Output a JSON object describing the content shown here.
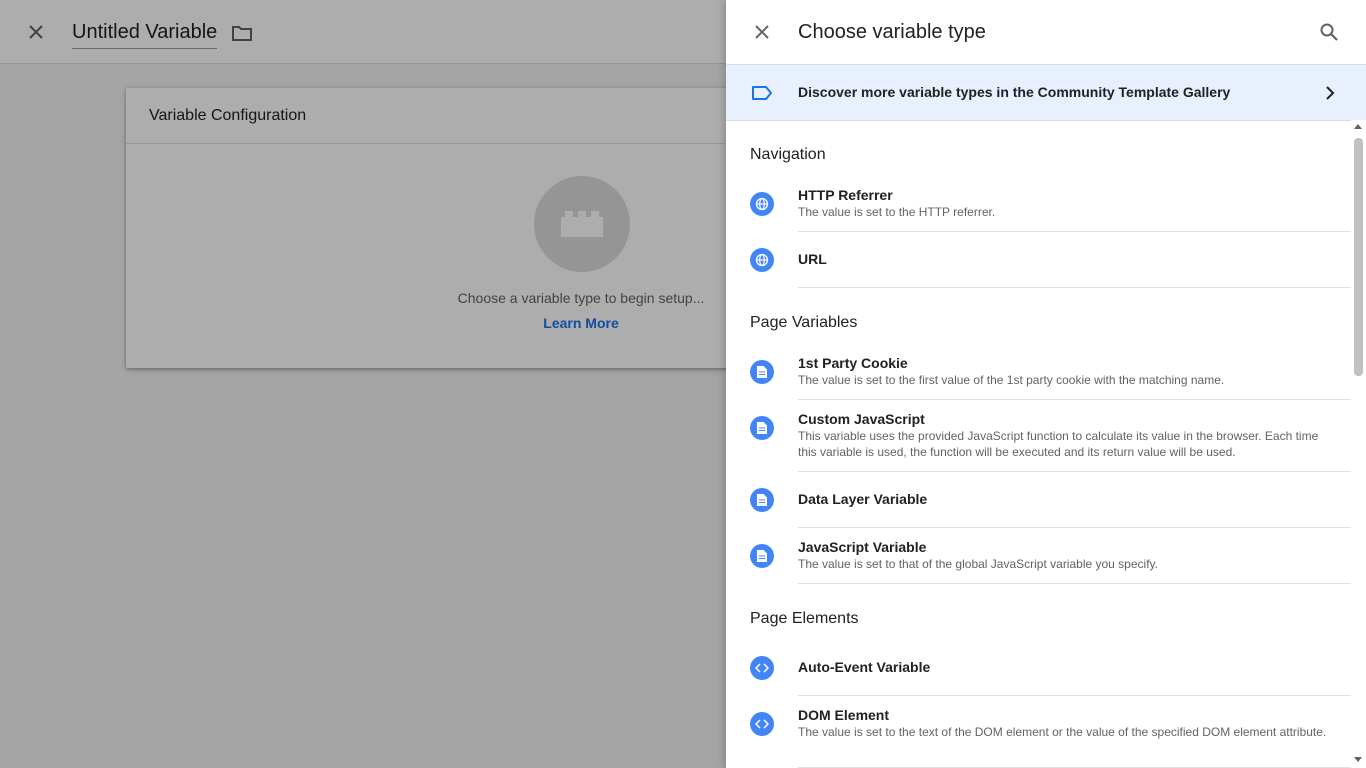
{
  "background": {
    "variable_name": "Untitled Variable",
    "card_title": "Variable Configuration",
    "empty_text": "Choose a variable type to begin setup...",
    "learn_more": "Learn More"
  },
  "drawer": {
    "title": "Choose variable type",
    "gallery_link": "Discover more variable types in the Community Template Gallery",
    "sections": [
      {
        "title": "Navigation",
        "items": [
          {
            "name": "HTTP Referrer",
            "desc": "The value is set to the HTTP referrer.",
            "icon": "globe-icon"
          },
          {
            "name": "URL",
            "desc": "",
            "icon": "globe-icon"
          }
        ]
      },
      {
        "title": "Page Variables",
        "items": [
          {
            "name": "1st Party Cookie",
            "desc": "The value is set to the first value of the 1st party cookie with the matching name.",
            "icon": "document-icon"
          },
          {
            "name": "Custom JavaScript",
            "desc": "This variable uses the provided JavaScript function to calculate its value in the browser. Each time this variable is used, the function will be executed and its return value will be used.",
            "icon": "document-icon"
          },
          {
            "name": "Data Layer Variable",
            "desc": "",
            "icon": "document-icon"
          },
          {
            "name": "JavaScript Variable",
            "desc": "The value is set to that of the global JavaScript variable you specify.",
            "icon": "document-icon"
          }
        ]
      },
      {
        "title": "Page Elements",
        "items": [
          {
            "name": "Auto-Event Variable",
            "desc": "",
            "icon": "code-icon"
          },
          {
            "name": "DOM Element",
            "desc": "The value is set to the text of the DOM element or the value of the specified DOM element attribute.",
            "icon": "code-icon"
          }
        ]
      }
    ]
  },
  "colors": {
    "accent": "#1a73e8",
    "icon_blue": "#4285f4",
    "gallery_bg": "#e8f0fe"
  }
}
